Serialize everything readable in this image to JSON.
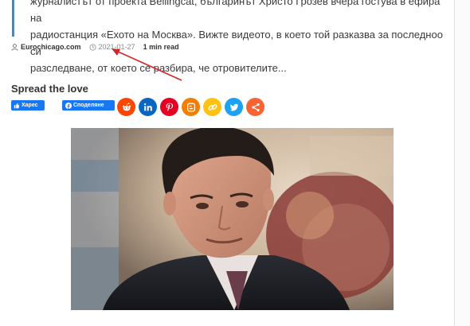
{
  "article": {
    "excerpt_line1": "журналистът от проекта Bellingcat, българинът Христо Грозев вчера гостува в ефира на",
    "excerpt_line2": "радиостанция «Ехото на Москва». Вижте видеото, в което той разказва за последноо си",
    "excerpt_line3": "разследване, от което се разбира, че отровителите..."
  },
  "meta": {
    "author": "Eurochicago.com",
    "date": "2021-01-27",
    "read_time": "1 min read",
    "author_icon": "user-icon",
    "date_icon": "clock-icon"
  },
  "share": {
    "title": "Spread the love",
    "like_label": "Харес",
    "share_label": "Споделяне",
    "buttons": [
      {
        "name": "reddit",
        "color": "#ff4500"
      },
      {
        "name": "linkedin",
        "color": "#0a66c2"
      },
      {
        "name": "pinterest",
        "color": "#e60023"
      },
      {
        "name": "blogger",
        "color": "#f57d00"
      },
      {
        "name": "copy-link",
        "color": "#ffc112"
      },
      {
        "name": "twitter",
        "color": "#1da1f2"
      },
      {
        "name": "more-share",
        "color": "#f96332"
      }
    ]
  },
  "colors": {
    "accent_border": "#2a8de6",
    "facebook_blue": "#1877f2",
    "annotation_arrow": "#d32626"
  }
}
